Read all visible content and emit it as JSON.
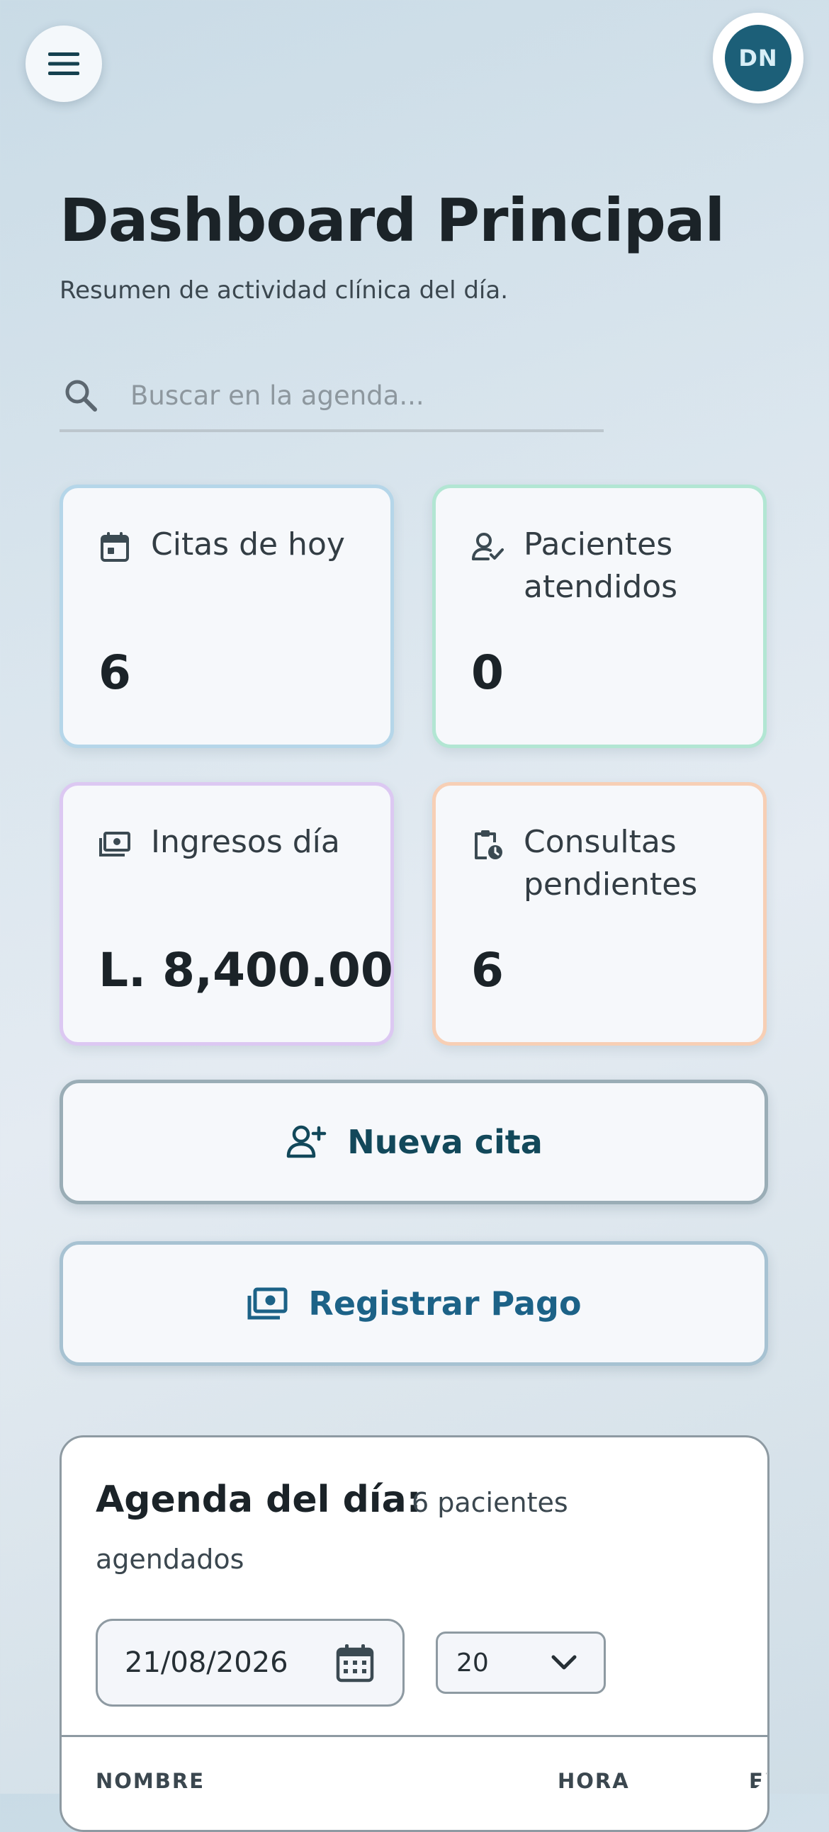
{
  "header": {
    "menu_icon": "hamburger-menu-icon",
    "avatar_initials": "DN"
  },
  "page": {
    "title": "Dashboard Principal",
    "subtitle": "Resumen de actividad clínica del día."
  },
  "search": {
    "placeholder": "Buscar en la agenda...",
    "value": "",
    "icon": "search-icon"
  },
  "stats": {
    "citas": {
      "label": "Citas de hoy",
      "value": "6",
      "icon": "calendar-icon",
      "border_color": "#b5d6e9"
    },
    "pacientes": {
      "label": "Pacientes atendidos",
      "value": "0",
      "icon": "user-check-icon",
      "border_color": "#b2e6d3"
    },
    "ingresos": {
      "label": "Ingresos día",
      "value": "L. 8,400.00",
      "icon": "money-icon",
      "border_color": "#dcc8f2"
    },
    "consultas": {
      "label": "Consultas pendientes",
      "value": "6",
      "icon": "clipboard-clock-icon",
      "border_color": "#f7cfb5"
    }
  },
  "actions": {
    "nueva_cita": {
      "label": "Nueva cita",
      "icon": "user-plus-icon",
      "color": "#12485a"
    },
    "registrar_pago": {
      "label": "Registrar Pago",
      "icon": "money-icon",
      "color": "#1c6287"
    }
  },
  "agenda": {
    "title": "Agenda del día:",
    "count_line1": "6 pacientes",
    "count_line2": "agendados",
    "date": "21/08/2026",
    "date_icon": "calendar-icon",
    "rows_per_page": "20",
    "rows_icon": "chevron-down-icon",
    "columns": [
      "NOMBRE",
      "HORA",
      "EI"
    ]
  }
}
